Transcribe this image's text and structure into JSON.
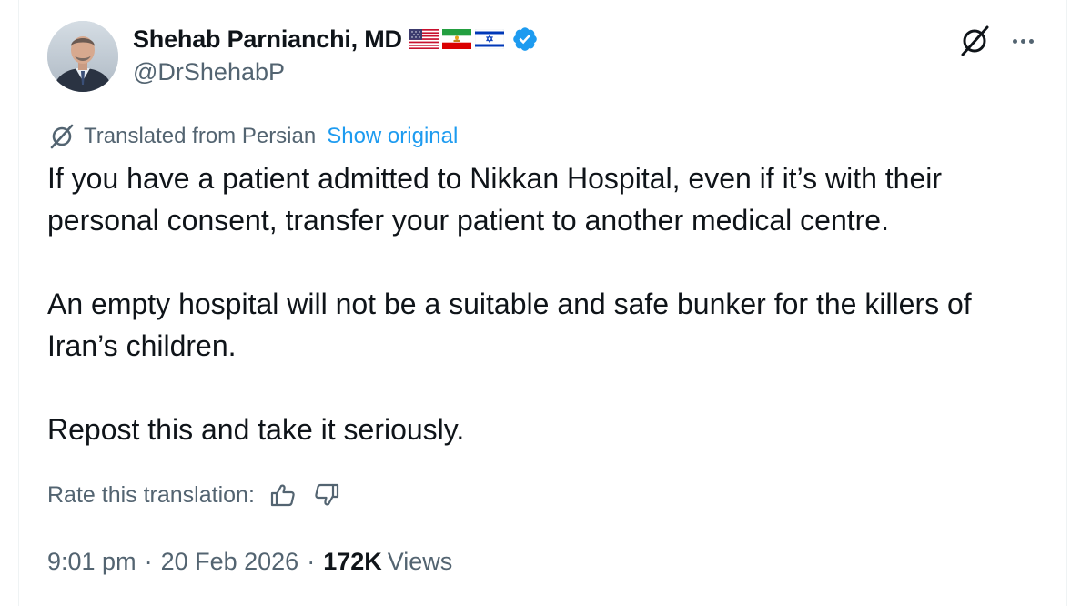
{
  "author": {
    "display_name": "Shehab Parnianchi, MD",
    "handle": "@DrShehabP",
    "flags": [
      "us-flag-icon",
      "iran-lion-sun-flag-icon",
      "israel-flag-icon"
    ],
    "verified": true,
    "verified_color": "#1d9bf0"
  },
  "actions": {
    "grok_icon": "grok-icon",
    "more_icon": "more-options-icon"
  },
  "translation": {
    "label": "Translated from Persian",
    "show_original": "Show original"
  },
  "tweet": {
    "paragraphs": [
      "If you have a patient admitted to Nikkan Hospital, even if it’s with their personal consent, transfer your patient to another medical centre.",
      "An empty hospital will not be a suitable and safe bunker for the killers of Iran’s children.",
      "Repost this and take it seriously."
    ]
  },
  "rating": {
    "label": "Rate this translation:"
  },
  "meta": {
    "time": "9:01 pm",
    "separator": "·",
    "date": "20 Feb 2026",
    "views_count": "172K",
    "views_label": "Views"
  },
  "colors": {
    "text_primary": "#0f1419",
    "text_secondary": "#536471",
    "link": "#1d9bf0",
    "border": "#eff3f4"
  }
}
